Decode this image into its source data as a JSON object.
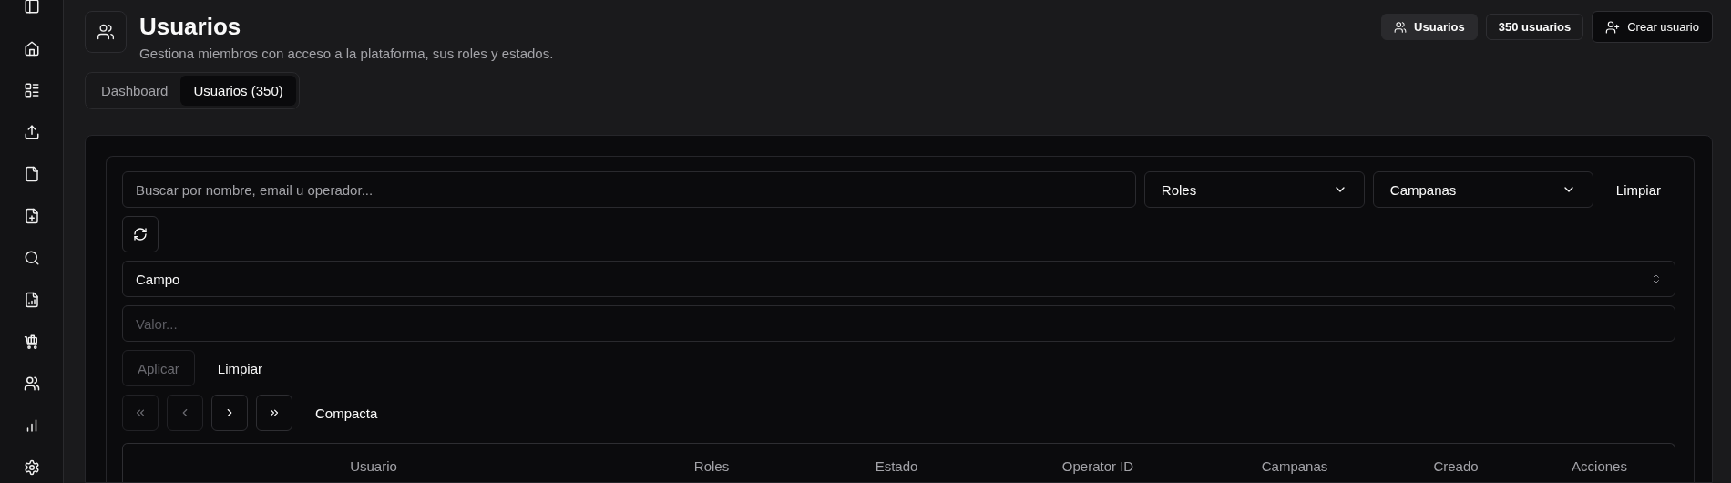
{
  "header": {
    "title": "Usuarios",
    "subtitle": "Gestiona miembros con acceso a la plataforma, sus roles y estados.",
    "actions": [
      {
        "kind": "badge",
        "label": "Usuarios"
      },
      {
        "kind": "outline",
        "label": "350 usuarios"
      },
      {
        "kind": "create",
        "label": "Crear usuario"
      }
    ]
  },
  "tabs": [
    {
      "label": "Dashboard",
      "selected": false
    },
    {
      "label": "Usuarios (350)",
      "selected": true
    }
  ],
  "filters": {
    "search": {
      "placeholder": "Buscar por nombre, email u operador..."
    },
    "dropdowns": [
      {
        "label": "Roles"
      },
      {
        "label": "Campanas"
      }
    ],
    "clear": "Limpiar"
  },
  "field_filter": {
    "field": {
      "value": "Campo"
    },
    "value": {
      "placeholder": "Valor..."
    },
    "apply": {
      "label": "Aplicar",
      "disabled": true
    },
    "clear": "Limpiar"
  },
  "pagination": {
    "buttons": [
      {
        "kind": "first",
        "disabled": true
      },
      {
        "kind": "prev",
        "disabled": true
      },
      {
        "kind": "next",
        "disabled": false
      },
      {
        "kind": "last",
        "disabled": false
      }
    ],
    "density": "Compacta"
  },
  "table": {
    "columns": [
      "Usuario",
      "Roles",
      "Estado",
      "Operator ID",
      "Campanas",
      "Creado",
      "Acciones"
    ]
  }
}
